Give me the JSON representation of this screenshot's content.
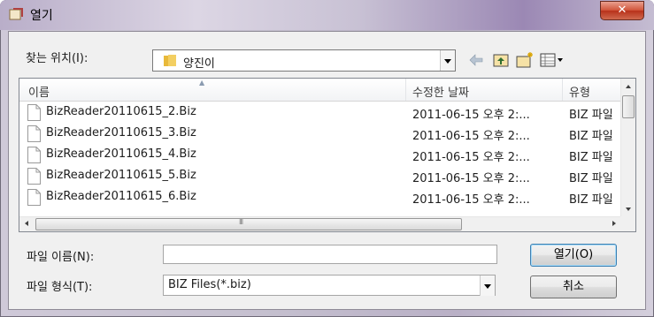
{
  "window": {
    "title": "열기"
  },
  "toolbar": {
    "look_in_label": "찾는 위치(I):",
    "look_in_value": "양진이"
  },
  "file_list": {
    "columns": [
      "이름",
      "수정한 날짜",
      "유형"
    ],
    "rows": [
      {
        "name": "BizReader20110615_2.Biz",
        "date": "2011-06-15 오후 2:...",
        "type": "BIZ 파일"
      },
      {
        "name": "BizReader20110615_3.Biz",
        "date": "2011-06-15 오후 2:...",
        "type": "BIZ 파일"
      },
      {
        "name": "BizReader20110615_4.Biz",
        "date": "2011-06-15 오후 2:...",
        "type": "BIZ 파일"
      },
      {
        "name": "BizReader20110615_5.Biz",
        "date": "2011-06-15 오후 2:...",
        "type": "BIZ 파일"
      },
      {
        "name": "BizReader20110615_6.Biz",
        "date": "2011-06-15 오후 2:...",
        "type": "BIZ 파일"
      }
    ]
  },
  "bottom": {
    "file_name_label": "파일 이름(N):",
    "file_name_value": "",
    "file_type_label": "파일 형식(T):",
    "file_type_value": "BIZ Files(*.biz)",
    "open_label": "열기(O)",
    "cancel_label": "취소"
  },
  "colors": {
    "close_button": "#c9452a",
    "window_frame": "#c5bdd2",
    "dialog_bg": "#f0f0f0"
  },
  "icons": [
    "app-icon",
    "close-icon",
    "folder-icon",
    "back-arrow-icon",
    "up-folder-icon",
    "new-folder-icon",
    "view-menu-icon",
    "file-icon"
  ]
}
